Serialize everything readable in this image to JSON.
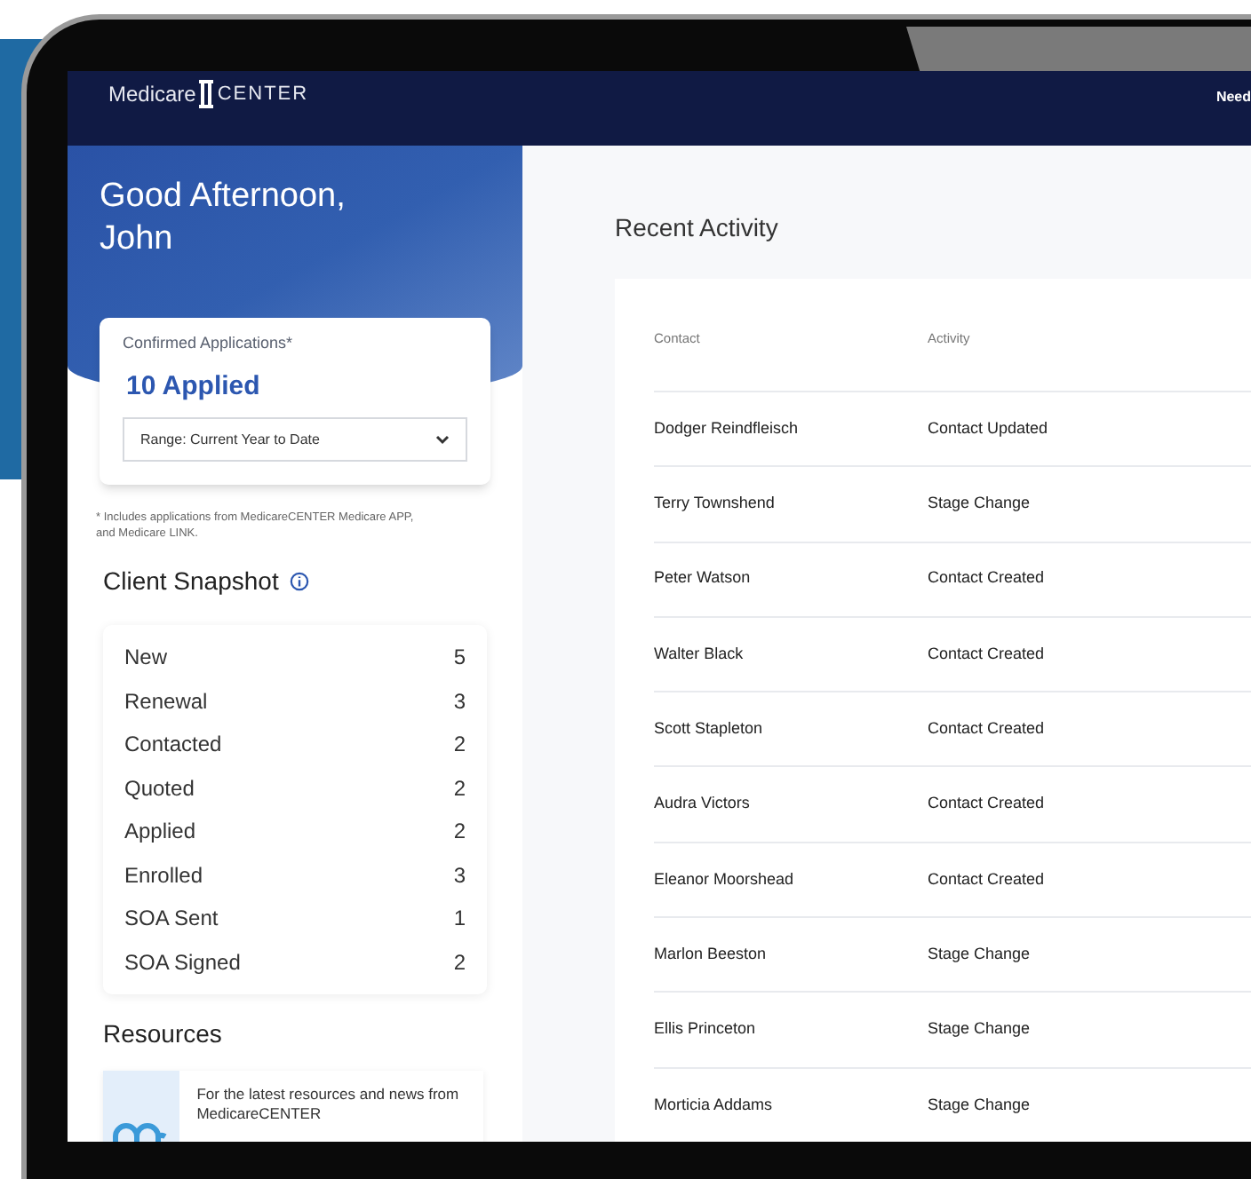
{
  "header": {
    "logo_left": "Medicare",
    "logo_right": "CENTER",
    "link": "Need"
  },
  "greeting": "Good Afternoon, John",
  "applications_card": {
    "label": "Confirmed Applications*",
    "value": "10 Applied",
    "range": "Range: Current Year to Date"
  },
  "footnote": "* Includes applications from MedicareCENTER Medicare APP, and Medicare LINK.",
  "snapshot": {
    "title": "Client Snapshot",
    "items": [
      {
        "label": "New",
        "count": "5"
      },
      {
        "label": "Renewal",
        "count": "3"
      },
      {
        "label": "Contacted",
        "count": "2"
      },
      {
        "label": "Quoted",
        "count": "2"
      },
      {
        "label": "Applied",
        "count": "2"
      },
      {
        "label": "Enrolled",
        "count": "3"
      },
      {
        "label": "SOA Sent",
        "count": "1"
      },
      {
        "label": "SOA Signed",
        "count": "2"
      }
    ]
  },
  "resources": {
    "title": "Resources",
    "text": "For the latest resources and news from MedicareCENTER"
  },
  "recent_activity": {
    "title": "Recent Activity",
    "columns": [
      "Contact",
      "Activity"
    ],
    "rows": [
      [
        "Dodger Reindfleisch",
        "Contact Updated"
      ],
      [
        "Terry Townshend",
        "Stage Change"
      ],
      [
        "Peter Watson",
        "Contact Created"
      ],
      [
        "Walter Black",
        "Contact Created"
      ],
      [
        "Scott Stapleton",
        "Contact Created"
      ],
      [
        "Audra Victors",
        "Contact Created"
      ],
      [
        "Eleanor Moorshead",
        "Contact Created"
      ],
      [
        "Marlon Beeston",
        "Stage Change"
      ],
      [
        "Ellis Princeton",
        "Stage Change"
      ],
      [
        "Morticia Addams",
        "Stage Change"
      ]
    ]
  }
}
